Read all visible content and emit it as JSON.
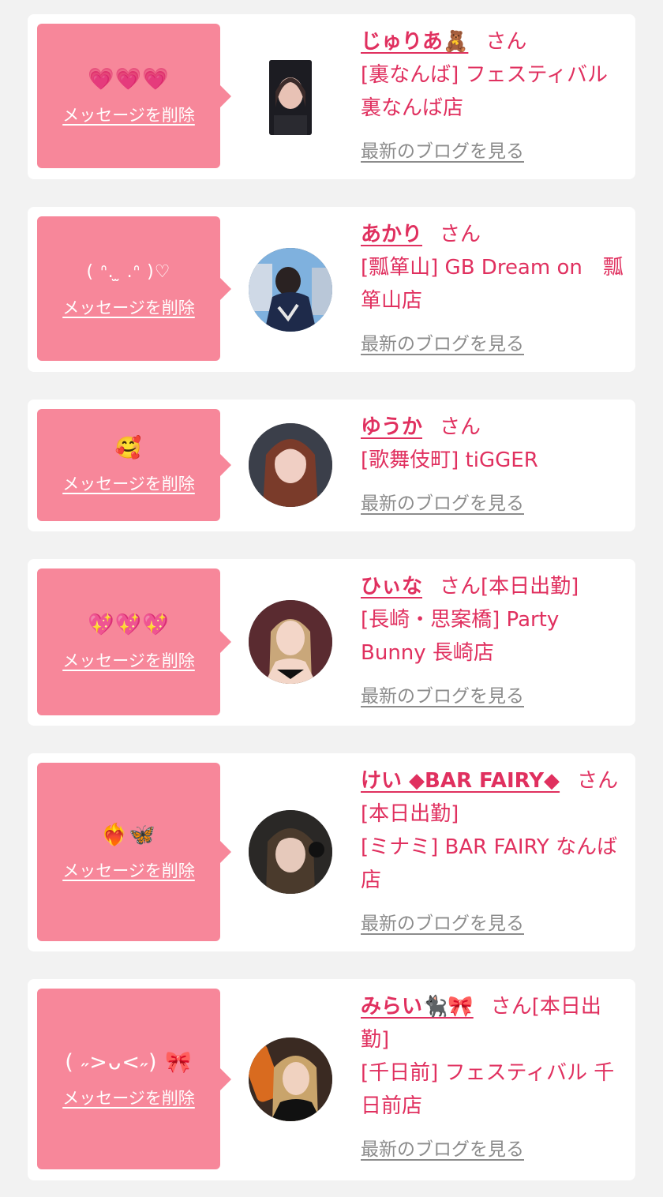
{
  "cards": [
    {
      "message": "💗💗💗",
      "delete_label": "メッセージを削除",
      "name": "じゅりあ🧸",
      "suffix": "さん",
      "shop": "[裏なんば] フェスティバル 裏なんば店",
      "blog_label": "最新のブログを見る",
      "avatar_colors": [
        "#1c1c22",
        "#e8c2b5",
        "#3b2b2a"
      ]
    },
    {
      "message": "( ᐢ. ̫ .ᐢ )♡",
      "delete_label": "メッセージを削除",
      "name": "あかり",
      "suffix": "さん",
      "shop": "[瓢箪山] GB Dream on　瓢箪山店",
      "blog_label": "最新のブログを見る",
      "avatar_colors": [
        "#7fb1de",
        "#1e2a4a",
        "#cfd9e6"
      ]
    },
    {
      "message": "🥰",
      "delete_label": "メッセージを削除",
      "name": "ゆうか",
      "suffix": "さん",
      "shop": "[歌舞伎町] tiGGER",
      "blog_label": "最新のブログを見る",
      "avatar_colors": [
        "#3b3f4a",
        "#f0cfc4",
        "#7a3b2a"
      ]
    },
    {
      "message": "💖💖💖",
      "delete_label": "メッセージを削除",
      "name": "ひぃな",
      "suffix": "さん[本日出勤]",
      "shop": "[長崎・思案橋] Party Bunny 長崎店",
      "blog_label": "最新のブログを見る",
      "avatar_colors": [
        "#5a2b30",
        "#f3d6c8",
        "#c9a77a"
      ]
    },
    {
      "message": "❤️‍🔥🦋",
      "delete_label": "メッセージを削除",
      "name": "けい ◆BAR FAIRY◆",
      "suffix": "さん",
      "status": "[本日出勤]",
      "shop": "[ミナミ] BAR FAIRY なんば店",
      "blog_label": "最新のブログを見る",
      "avatar_colors": [
        "#2a2826",
        "#e6c9bb",
        "#4a3a2c"
      ]
    },
    {
      "message": "( ˶>ᴗ<˶) 🎀",
      "delete_label": "メッセージを削除",
      "name": "みらい🐈‍⬛🎀",
      "suffix": "さん[本日出勤]",
      "shop": "[千日前] フェスティバル 千日前店",
      "blog_label": "最新のブログを見る",
      "avatar_colors": [
        "#d96b1f",
        "#f0d2c0",
        "#c9a46b"
      ]
    }
  ]
}
